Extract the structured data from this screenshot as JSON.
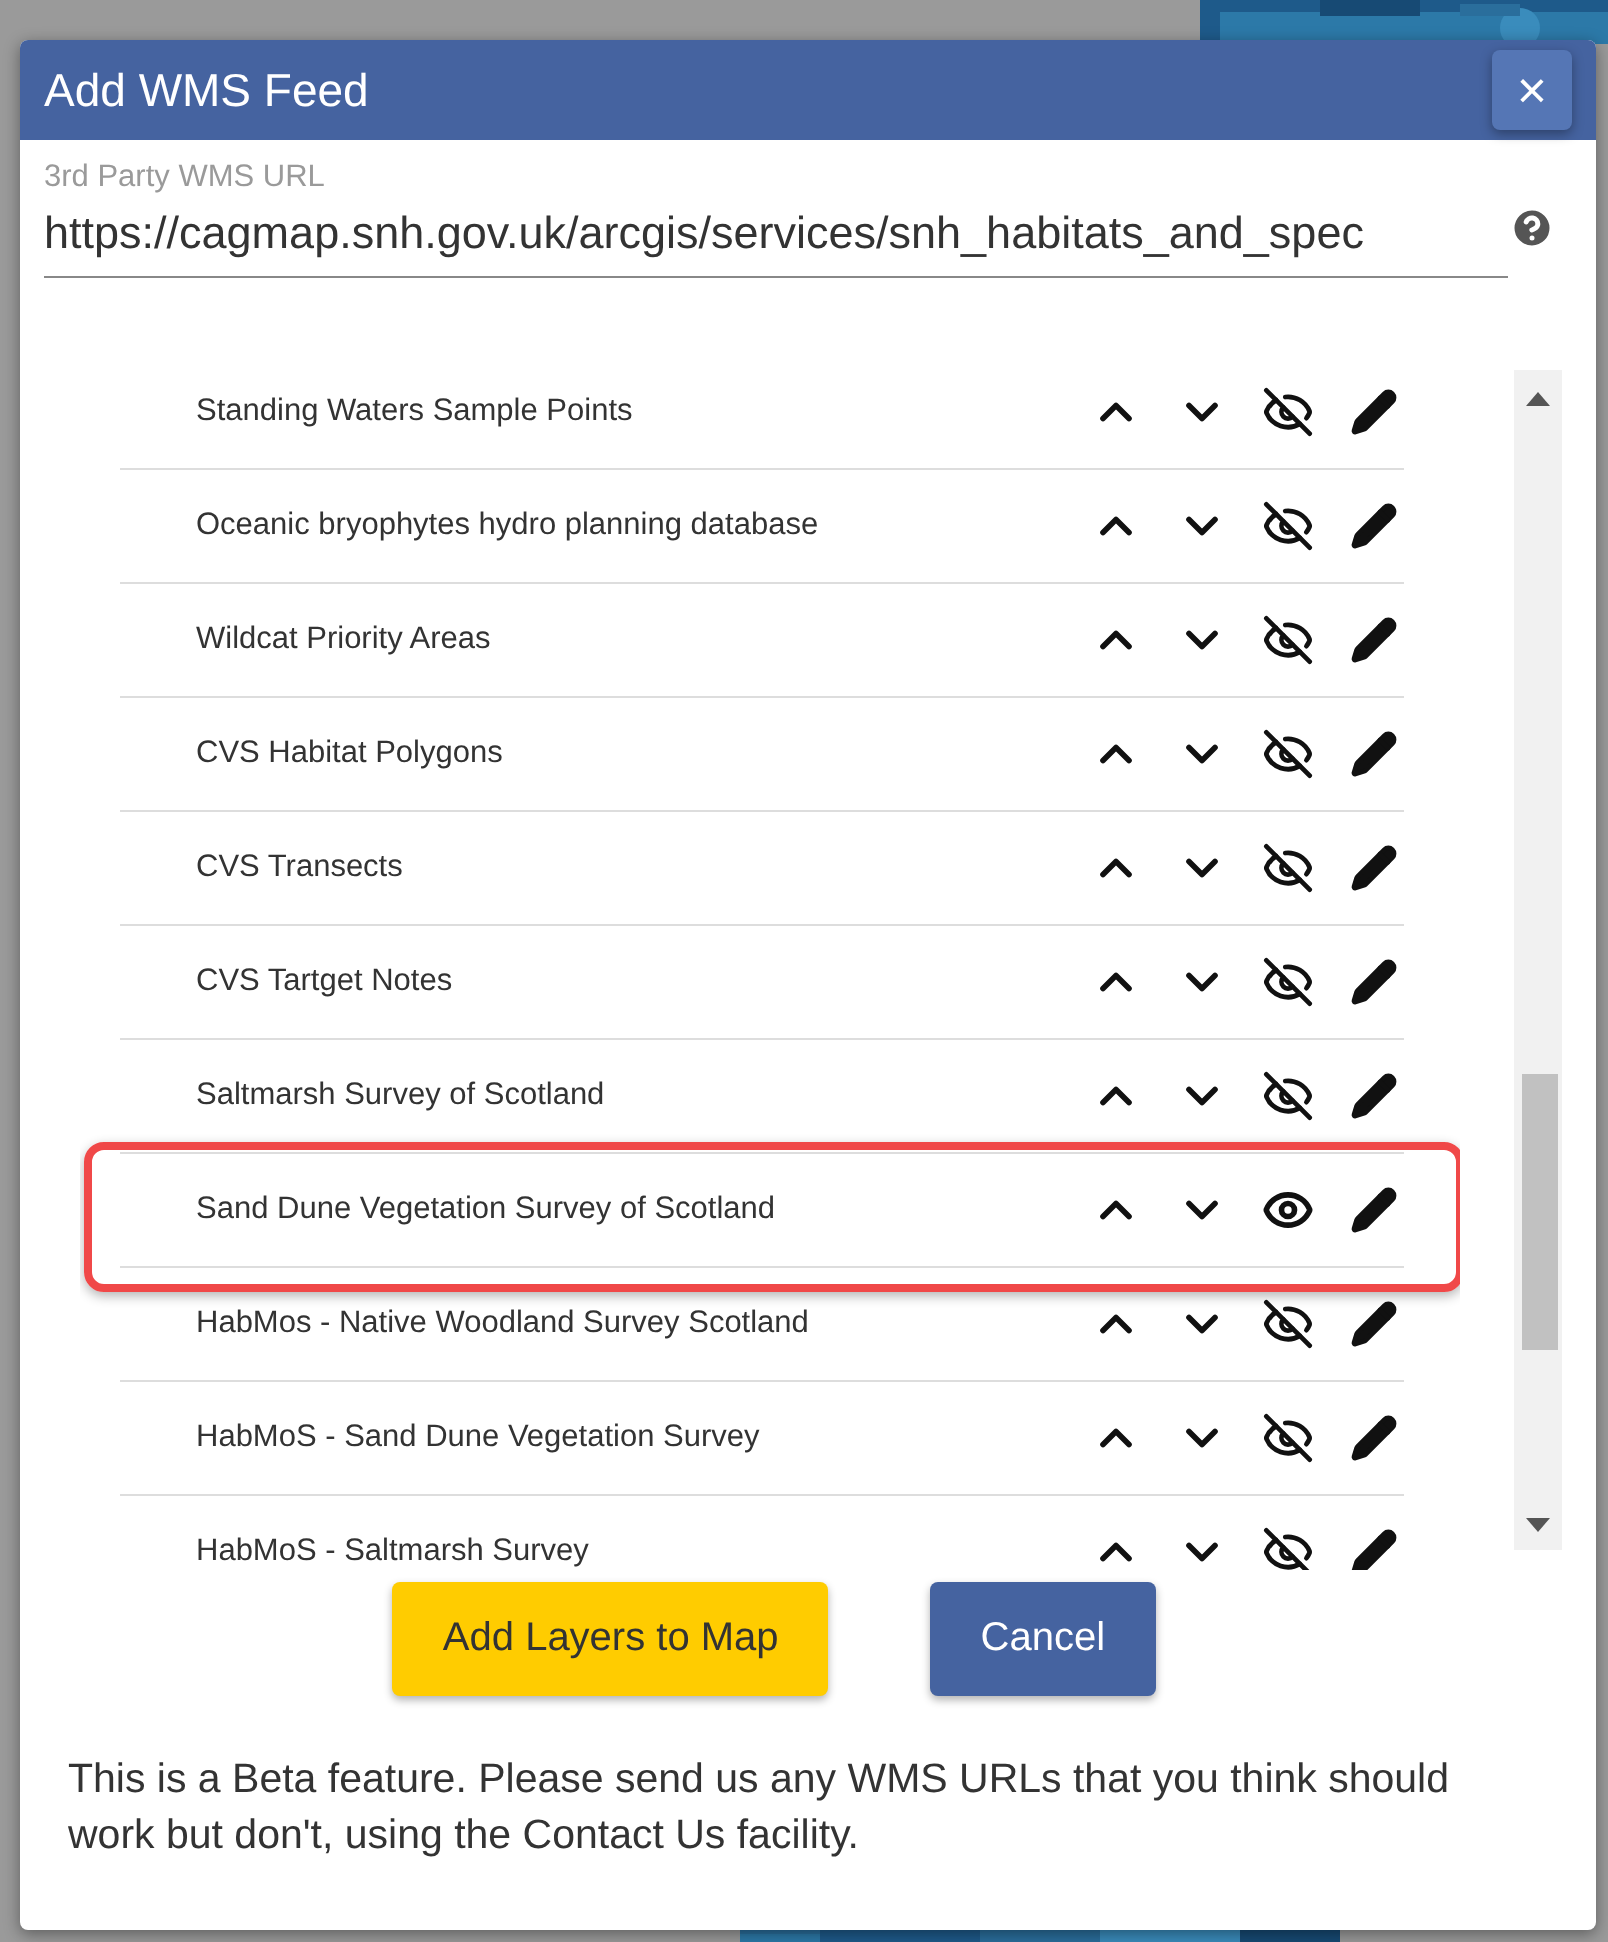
{
  "dialog": {
    "title": "Add WMS Feed",
    "close": "×"
  },
  "url_field": {
    "label": "3rd Party WMS URL",
    "value": "https://cagmap.snh.gov.uk/arcgis/services/snh_habitats_and_spec"
  },
  "layers": [
    {
      "name": "Standing Waters Sample Points",
      "visible": false,
      "highlighted": false
    },
    {
      "name": "Oceanic bryophytes hydro planning database",
      "visible": false,
      "highlighted": false
    },
    {
      "name": "Wildcat Priority Areas",
      "visible": false,
      "highlighted": false
    },
    {
      "name": "CVS Habitat Polygons",
      "visible": false,
      "highlighted": false
    },
    {
      "name": "CVS Transects",
      "visible": false,
      "highlighted": false
    },
    {
      "name": "CVS Tartget Notes",
      "visible": false,
      "highlighted": false
    },
    {
      "name": "Saltmarsh Survey of Scotland",
      "visible": false,
      "highlighted": false
    },
    {
      "name": "Sand Dune Vegetation Survey of Scotland",
      "visible": true,
      "highlighted": true
    },
    {
      "name": "HabMos - Native Woodland Survey Scotland",
      "visible": false,
      "highlighted": false
    },
    {
      "name": "HabMoS - Sand Dune Vegetation Survey",
      "visible": false,
      "highlighted": false
    },
    {
      "name": "HabMoS - Saltmarsh Survey",
      "visible": false,
      "highlighted": false
    }
  ],
  "buttons": [
    {
      "label": "Add Layers to Map",
      "kind": "primary"
    },
    {
      "label": "Cancel",
      "kind": "secondary"
    }
  ],
  "note": "This is a Beta feature. Please send us any WMS URLs that you think should work but don't, using the Contact Us facility."
}
